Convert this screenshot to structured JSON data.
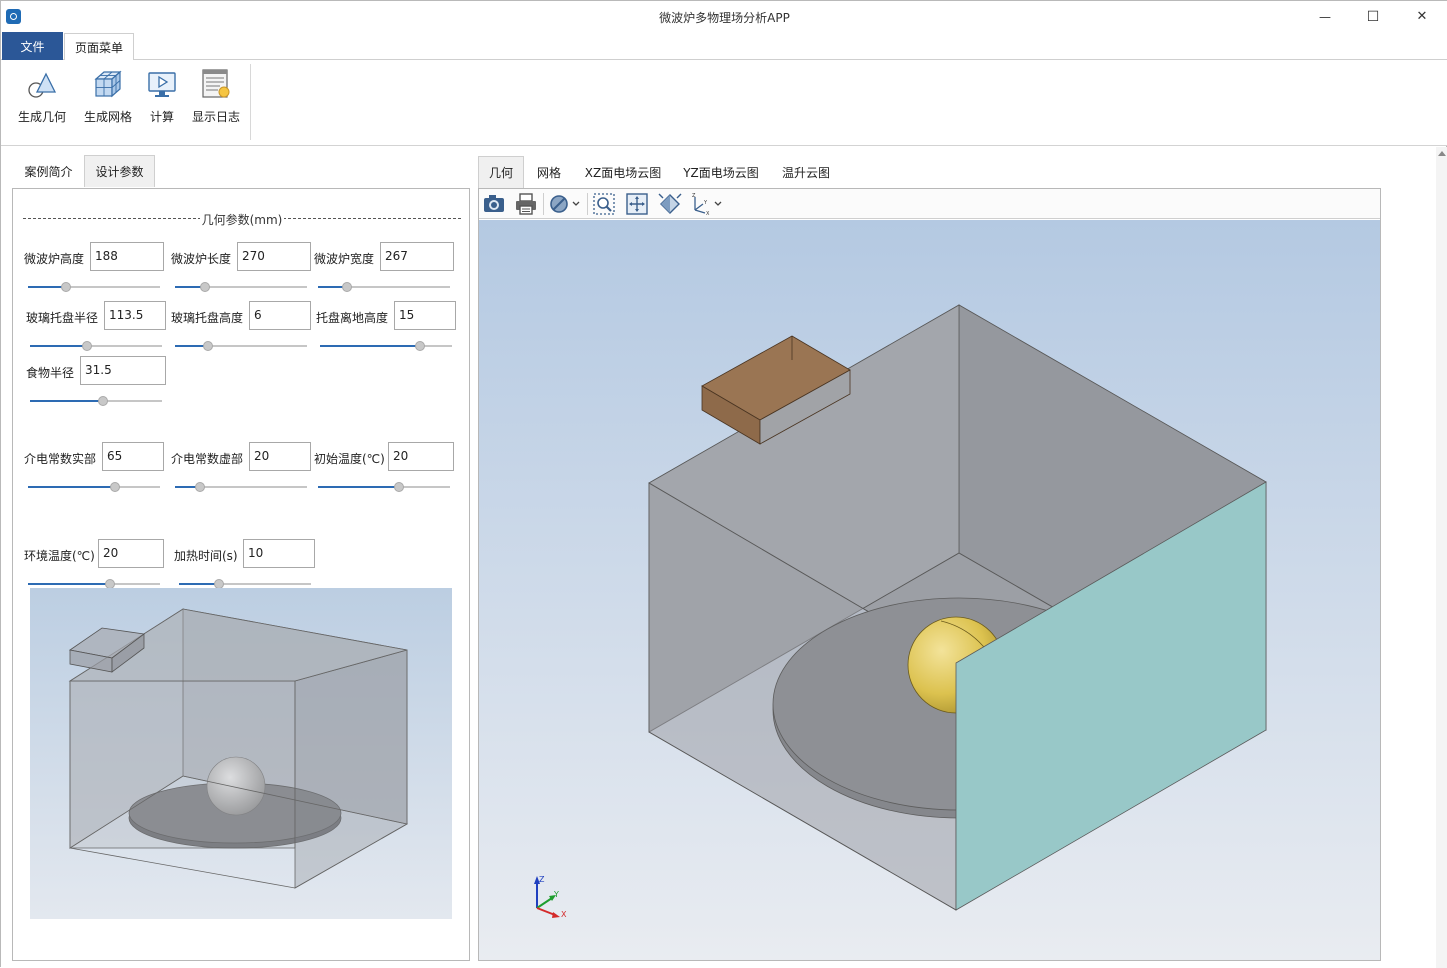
{
  "app": {
    "title": "微波炉多物理场分析APP",
    "accent": "#2b5797"
  },
  "window_controls": {
    "minimize": "—",
    "maximize": "☐",
    "close": "✕"
  },
  "menu": {
    "file": "文件",
    "page_menu": "页面菜单"
  },
  "ribbon": [
    {
      "label": "生成几何",
      "icon": "geometry-shapes-icon"
    },
    {
      "label": "生成网格",
      "icon": "mesh-cube-icon"
    },
    {
      "label": "计算",
      "icon": "compute-monitor-icon"
    },
    {
      "label": "显示日志",
      "icon": "log-document-icon"
    }
  ],
  "left_tabs": {
    "intro": "案例简介",
    "params": "设计参数"
  },
  "section_title": "几何参数(mm)",
  "params": {
    "height": {
      "label": "微波炉高度",
      "value": "188",
      "slider": 0.29
    },
    "length": {
      "label": "微波炉长度",
      "value": "270",
      "slider": 0.23
    },
    "width": {
      "label": "微波炉宽度",
      "value": "267",
      "slider": 0.22
    },
    "tray_radius": {
      "label": "玻璃托盘半径",
      "value": "113.5",
      "slider": 0.43
    },
    "tray_height": {
      "label": "玻璃托盘高度",
      "value": "6",
      "slider": 0.25
    },
    "tray_lift": {
      "label": "托盘离地高度",
      "value": "15",
      "slider": 0.76
    },
    "food_radius": {
      "label": "食物半径",
      "value": "31.5",
      "slider": 0.55
    },
    "eps_real": {
      "label": "介电常数实部",
      "value": "65",
      "slider": 0.66
    },
    "eps_imag": {
      "label": "介电常数虚部",
      "value": "20",
      "slider": 0.19
    },
    "init_temp": {
      "label": "初始温度(℃)",
      "value": "20",
      "slider": 0.61
    },
    "env_temp": {
      "label": "环境温度(℃)",
      "value": "20",
      "slider": 0.62
    },
    "heat_time": {
      "label": "加热时间(s)",
      "value": "10",
      "slider": 0.3
    }
  },
  "right_tabs": {
    "geometry": "几何",
    "mesh": "网格",
    "xz": "XZ面电场云图",
    "yz": "YZ面电场云图",
    "temp": "温升云图"
  },
  "viewer_toolbar": [
    "camera-icon",
    "print-icon",
    "hide-icon",
    "zoom-box-icon",
    "fit-view-icon",
    "rotate-view-icon",
    "axes-orientation-icon"
  ],
  "axis_triad": {
    "x": "X",
    "y": "Y",
    "z": "Z"
  },
  "colors": {
    "slider_fill": "#2d6bb3",
    "face_teal": "#98c8c8",
    "food_yellow": "#e3cc5e",
    "waveguide_brown": "#9a7553"
  }
}
